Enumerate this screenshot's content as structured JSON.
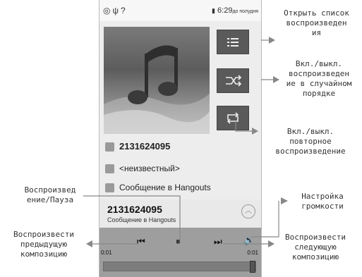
{
  "status_bar": {
    "left_icons": [
      "target-icon",
      "usb-icon",
      "question-icon"
    ],
    "time": "6:29",
    "time_suffix": "до полудня"
  },
  "track_info": {
    "number": "2131624095",
    "artist": "<неизвестный>",
    "album": "Сообщение в Hangouts"
  },
  "now_playing": {
    "title": "2131624095",
    "subtitle": "Сообщение в Hangouts"
  },
  "playback": {
    "time_elapsed": "0:01",
    "time_total": "0:01",
    "progress": 1.0
  },
  "callouts": {
    "open_playlist": "Открыть список\nвоспроизведен\nия",
    "shuffle": "Вкл./выкл.\nвоспроизведен\nие в случайном\nпорядке",
    "repeat": "Вкл./выкл.\nповторное\nвоспроизведение",
    "play_pause": "Воспроизвед\nение/Пауза",
    "volume": "Настройка\nгромкости",
    "previous": "Воспроизвести\nпредыдущую\nкомпозицию",
    "next": "Воспроизвести\nследующую\nкомпозицию"
  }
}
